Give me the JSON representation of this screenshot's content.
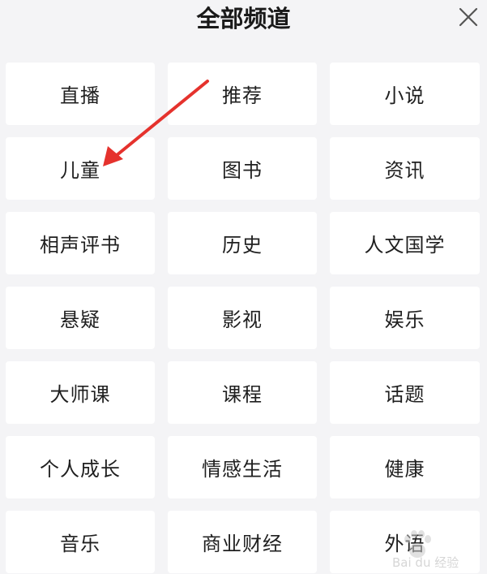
{
  "header": {
    "title": "全部频道",
    "close_icon": "close-icon"
  },
  "channels": [
    "直播",
    "推荐",
    "小说",
    "儿童",
    "图书",
    "资讯",
    "相声评书",
    "历史",
    "人文国学",
    "悬疑",
    "影视",
    "娱乐",
    "大师课",
    "课程",
    "话题",
    "个人成长",
    "情感生活",
    "健康",
    "音乐",
    "商业财经",
    "外语"
  ],
  "annotation": {
    "color": "#e5322d",
    "points_to": "儿童"
  },
  "watermark": {
    "text": "Bai du 经验",
    "icon": "paw-icon"
  },
  "colors": {
    "background": "#f4f4f6",
    "tile": "#ffffff",
    "text": "#1f1f1f"
  }
}
